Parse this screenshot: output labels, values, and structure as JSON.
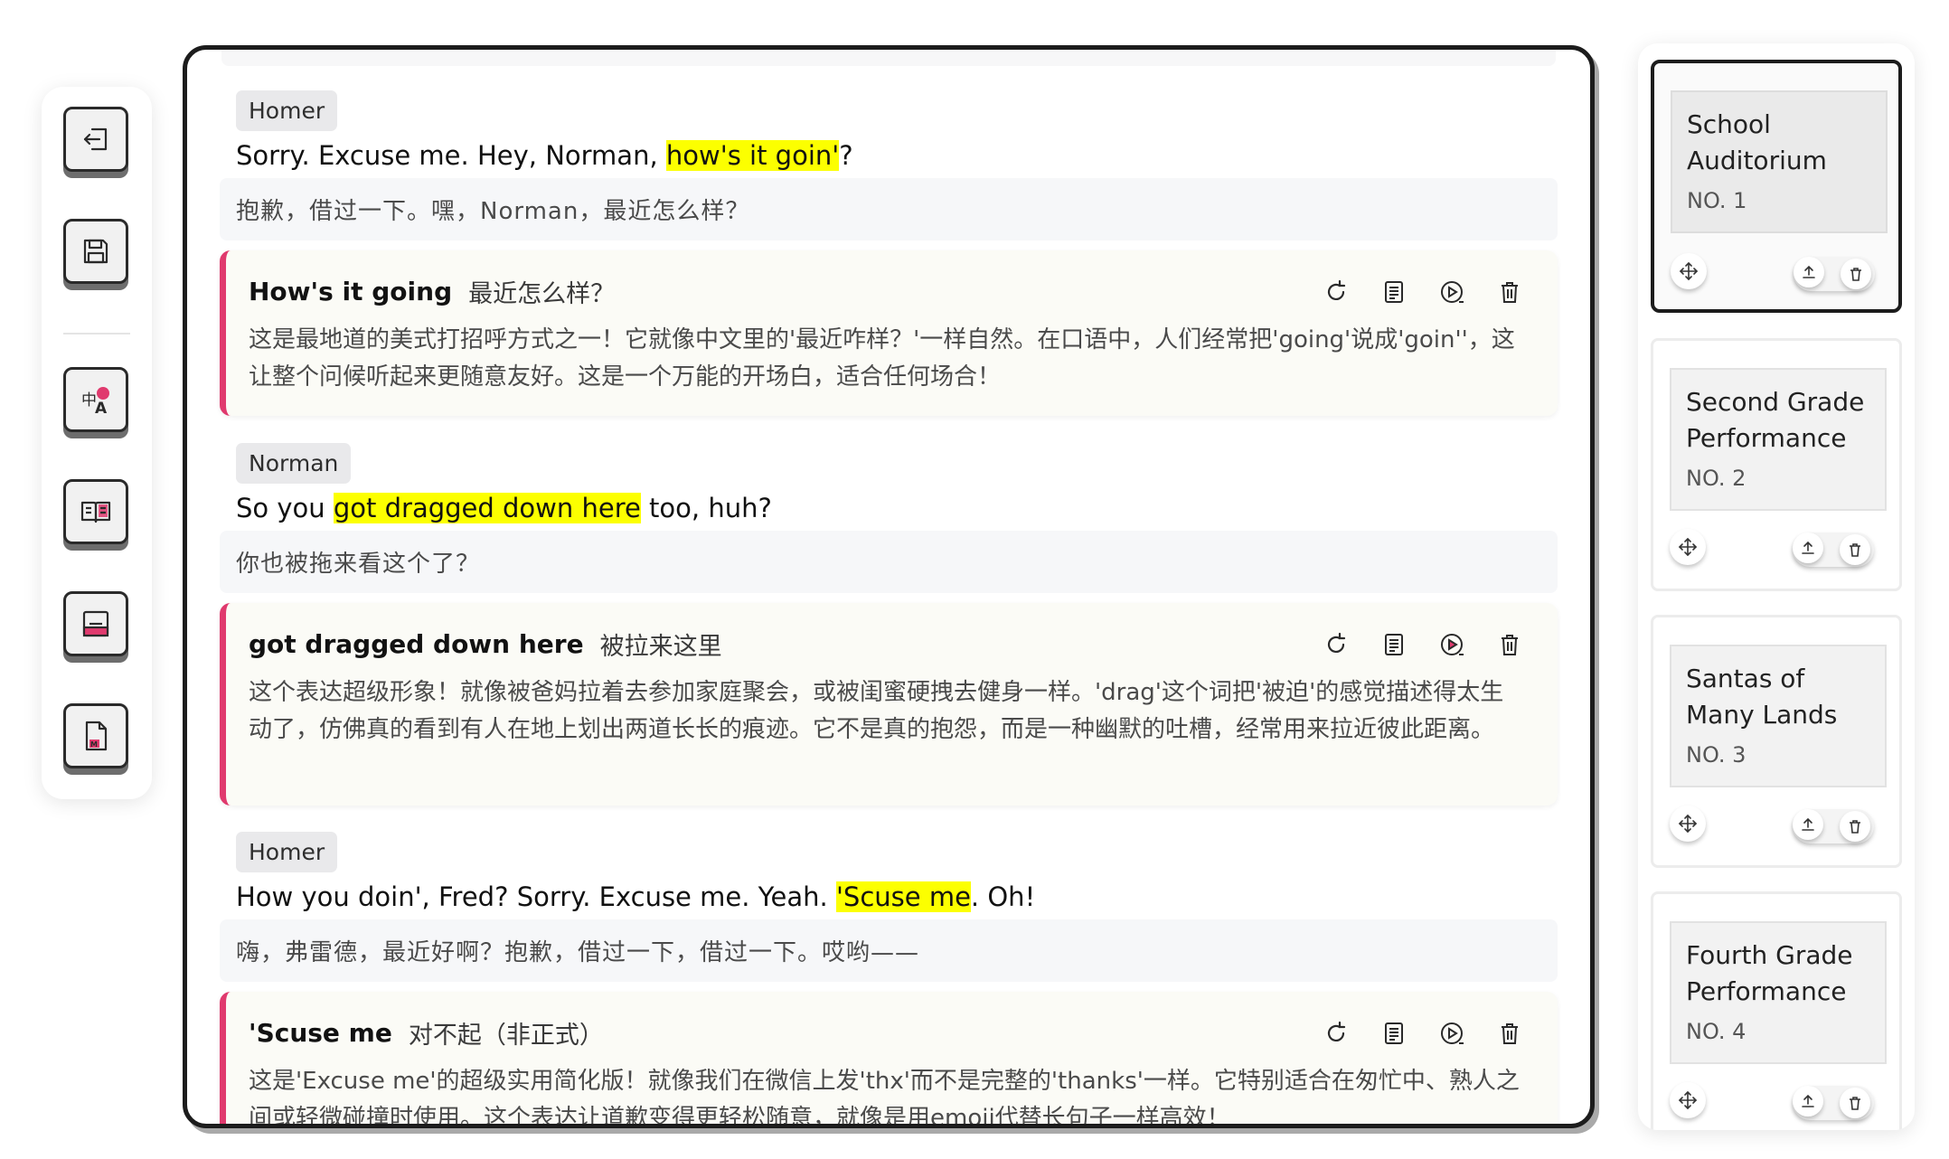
{
  "toolbar": {
    "buttons": [
      {
        "icon": "exit-icon"
      },
      {
        "icon": "save-icon"
      },
      {
        "icon": "translate-icon"
      },
      {
        "icon": "book-icon"
      },
      {
        "icon": "subtitle-icon"
      },
      {
        "icon": "markdown-file-icon"
      }
    ]
  },
  "segments": [
    {
      "speaker": "Homer",
      "en_before": "Sorry. Excuse me. Hey, Norman, ",
      "en_highlight": "how's it goin'",
      "en_after": "?",
      "zh": "抱歉，借过一下。嘿，Norman，最近怎么样？",
      "note": {
        "term": "How's it going",
        "translation": "最近怎么样？",
        "body": "这是最地道的美式打招呼方式之一！它就像中文里的'最近咋样？'一样自然。在口语中，人们经常把'going'说成'goin''，这让整个问候听起来更随意友好。这是一个万能的开场白，适合任何场合！"
      }
    },
    {
      "speaker": "Norman",
      "en_before": "So you ",
      "en_highlight": "got dragged down here",
      "en_after": " too, huh?",
      "zh": "你也被拖来看这个了？",
      "note": {
        "term": "got dragged down here",
        "translation": "被拉来这里",
        "body": "这个表达超级形象！就像被爸妈拉着去参加家庭聚会，或被闺蜜硬拽去健身一样。'drag'这个词把'被迫'的感觉描述得太生动了，仿佛真的看到有人在地上划出两道长长的痕迹。它不是真的抱怨，而是一种幽默的吐槽，经常用来拉近彼此距离。"
      }
    },
    {
      "speaker": "Homer",
      "en_before": "How you doin', Fred? Sorry. Excuse me. Yeah. ",
      "en_highlight": "'Scuse me",
      "en_after": ". Oh!",
      "zh": "嗨，弗雷德，最近好啊？抱歉，借过一下，借过一下。哎哟——",
      "note": {
        "term": "'Scuse me",
        "translation": "对不起（非正式）",
        "body": "这是'Excuse me'的超级实用简化版！就像我们在微信上发'thx'而不是完整的'thanks'一样。它特别适合在匆忙中、熟人之间或轻微碰撞时使用。这个表达让道歉变得更轻松随意，就像是用emoji代替长句子一样高效！"
      }
    }
  ],
  "playlist": [
    {
      "title": "School Auditorium",
      "no": "NO. 1",
      "active": true
    },
    {
      "title": "Second Grade Performance",
      "no": "NO. 2",
      "active": false
    },
    {
      "title": "Santas of Many Lands",
      "no": "NO. 3",
      "active": false
    },
    {
      "title": "Fourth Grade Performance",
      "no": "NO. 4",
      "active": false
    }
  ],
  "colors": {
    "highlight": "#fcff00",
    "accent": "#e03a6e",
    "border": "#1c1c1c"
  }
}
